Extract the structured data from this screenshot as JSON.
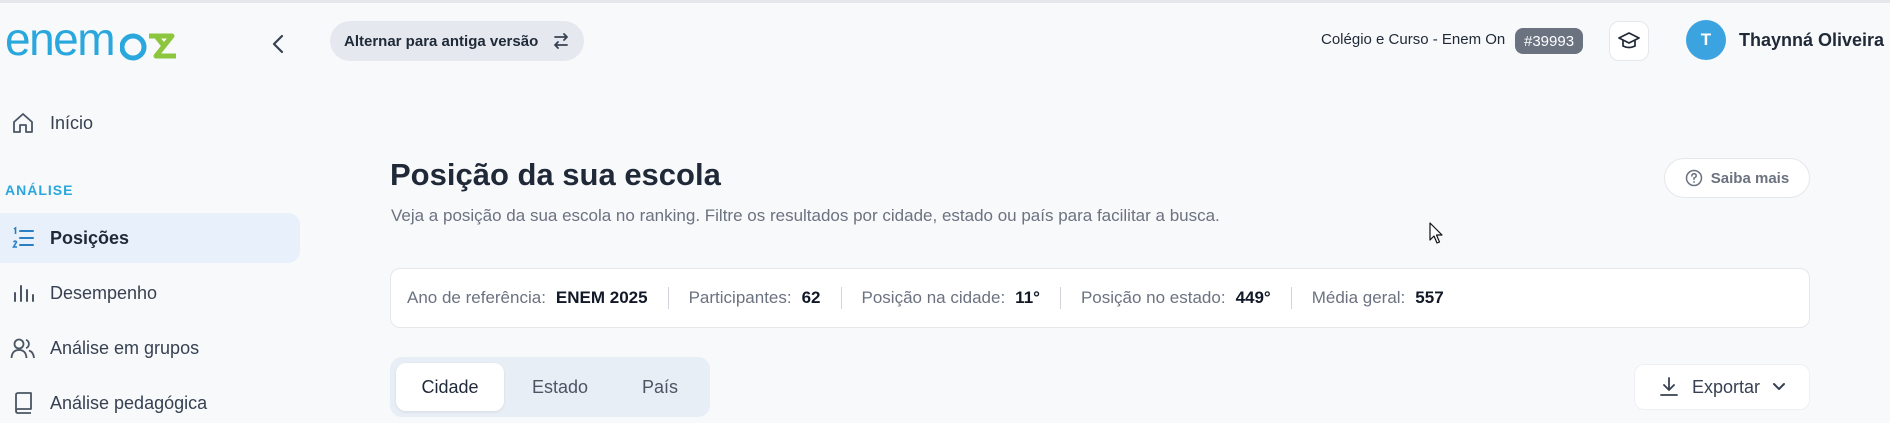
{
  "app": {
    "logo_text": "enem",
    "logo_suffix": "ON"
  },
  "sidebar": {
    "section_label": "ANÁLISE",
    "items": [
      {
        "label": "Início",
        "icon": "home-icon"
      },
      {
        "label": "Posições",
        "icon": "list-numbered-icon",
        "active": true
      },
      {
        "label": "Desempenho",
        "icon": "bar-chart-icon"
      },
      {
        "label": "Análise em grupos",
        "icon": "users-icon"
      },
      {
        "label": "Análise pedagógica",
        "icon": "book-icon"
      }
    ]
  },
  "header": {
    "switch_label": "Alternar para antiga versão",
    "school_name": "Colégio e Curso - Enem On",
    "school_id": "#39993",
    "avatar_initial": "T",
    "user_name": "Thaynná Oliveira"
  },
  "main": {
    "title": "Posição da sua escola",
    "subtitle": "Veja a posição da sua escola no ranking. Filtre os resultados por cidade, estado ou país para facilitar a busca.",
    "help_label": "Saiba mais",
    "stats": [
      {
        "label": "Ano de referência:",
        "value": "ENEM 2025"
      },
      {
        "label": "Participantes:",
        "value": "62"
      },
      {
        "label": "Posição na cidade:",
        "value": "11°"
      },
      {
        "label": "Posição no estado:",
        "value": "449°"
      },
      {
        "label": "Média geral:",
        "value": "557"
      }
    ],
    "tabs": [
      {
        "label": "Cidade",
        "active": true
      },
      {
        "label": "Estado"
      },
      {
        "label": "País"
      }
    ],
    "export_label": "Exportar"
  },
  "colors": {
    "brand_blue": "#2aa7dc",
    "brand_green": "#8cc63f",
    "active_bg": "#e8f1fb",
    "badge_gray": "#6b7280"
  }
}
